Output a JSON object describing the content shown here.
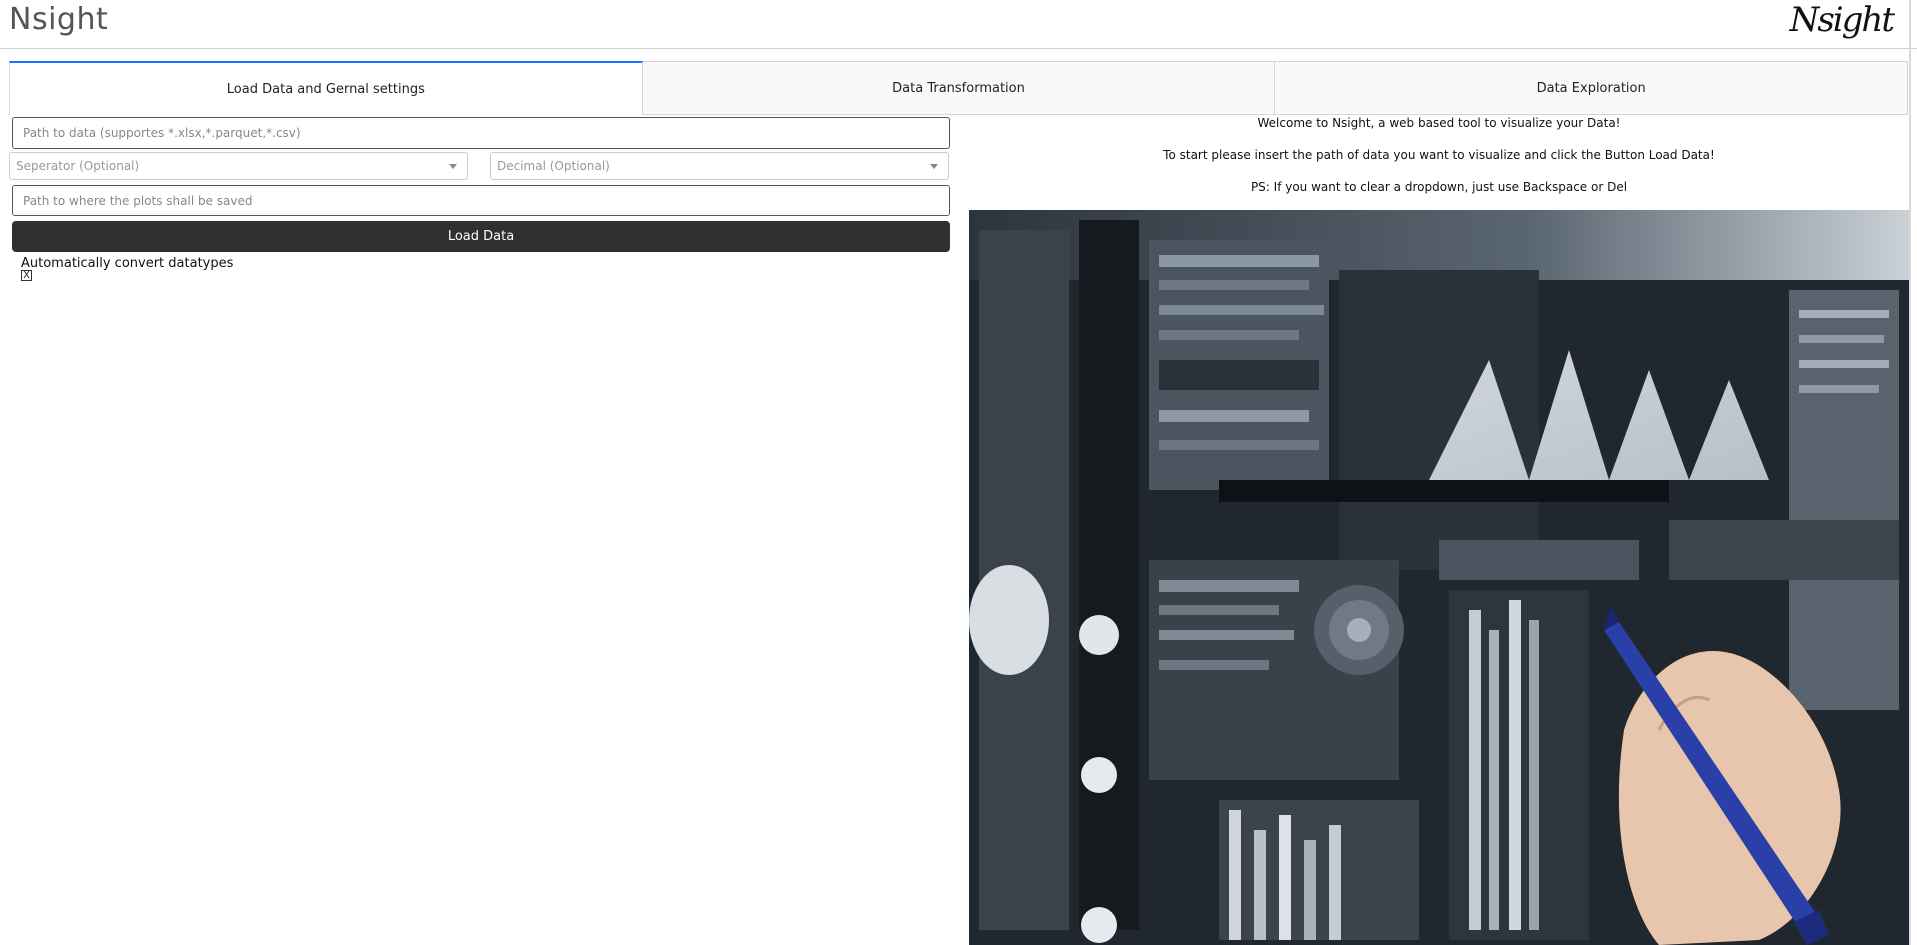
{
  "header": {
    "title": "Nsight",
    "logo_text": "Nsight"
  },
  "tabs": [
    {
      "label": "Load Data and Gernal settings",
      "active": true
    },
    {
      "label": "Data Transformation",
      "active": false
    },
    {
      "label": "Data Exploration",
      "active": false
    }
  ],
  "load_panel": {
    "data_path_placeholder": "Path to data (supportes *.xlsx,*.parquet,*.csv)",
    "separator_placeholder": "Seperator (Optional)",
    "decimal_placeholder": "Decimal (Optional)",
    "plots_path_placeholder": "Path to where the plots shall be saved",
    "load_button_label": "Load Data",
    "auto_convert_label": "Automatically convert datatypes",
    "auto_convert_checked": true,
    "checkbox_mark": "X"
  },
  "welcome": {
    "line1": "Welcome to Nsight, a web based tool to visualize your Data!",
    "line2": "To start please insert the path of data you want to visualize and click the Button Load Data!",
    "line3": "PS: If you want to clear a dropdown, just use Backspace or Del"
  },
  "colors": {
    "accent": "#1975fa",
    "button_bg": "#303030",
    "pen_blue": "#2a3fa8"
  },
  "hero_image": {
    "icon": "data-visualization-illustration"
  }
}
